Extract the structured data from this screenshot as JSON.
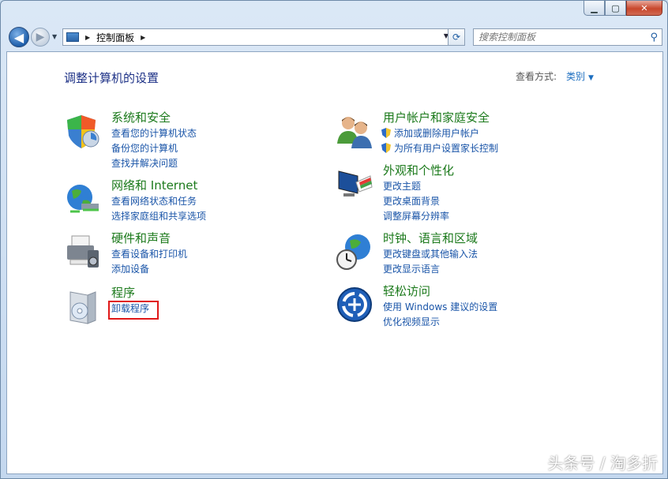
{
  "nav": {
    "breadcrumb": "控制面板",
    "search_placeholder": "搜索控制面板"
  },
  "page": {
    "title": "调整计算机的设置",
    "view_by_label": "查看方式:",
    "view_by_value": "类别"
  },
  "categories": [
    {
      "title": "系统和安全",
      "links": [
        "查看您的计算机状态",
        "备份您的计算机",
        "查找并解决问题"
      ]
    },
    {
      "title": "网络和 Internet",
      "links": [
        "查看网络状态和任务",
        "选择家庭组和共享选项"
      ]
    },
    {
      "title": "硬件和声音",
      "links": [
        "查看设备和打印机",
        "添加设备"
      ]
    },
    {
      "title": "程序",
      "links": [
        "卸载程序"
      ]
    },
    {
      "title": "用户帐户和家庭安全",
      "links": [
        "添加或删除用户帐户",
        "为所有用户设置家长控制"
      ]
    },
    {
      "title": "外观和个性化",
      "links": [
        "更改主题",
        "更改桌面背景",
        "调整屏幕分辨率"
      ]
    },
    {
      "title": "时钟、语言和区域",
      "links": [
        "更改键盘或其他输入法",
        "更改显示语言"
      ]
    },
    {
      "title": "轻松访问",
      "links": [
        "使用 Windows 建议的设置",
        "优化视频显示"
      ]
    }
  ],
  "watermark": "头条号 / 淘多折",
  "colors": {
    "title_green": "#1c7a1c",
    "link_blue": "#1a55a8",
    "heading_blue": "#1e3287",
    "highlight_red": "#e01818"
  }
}
